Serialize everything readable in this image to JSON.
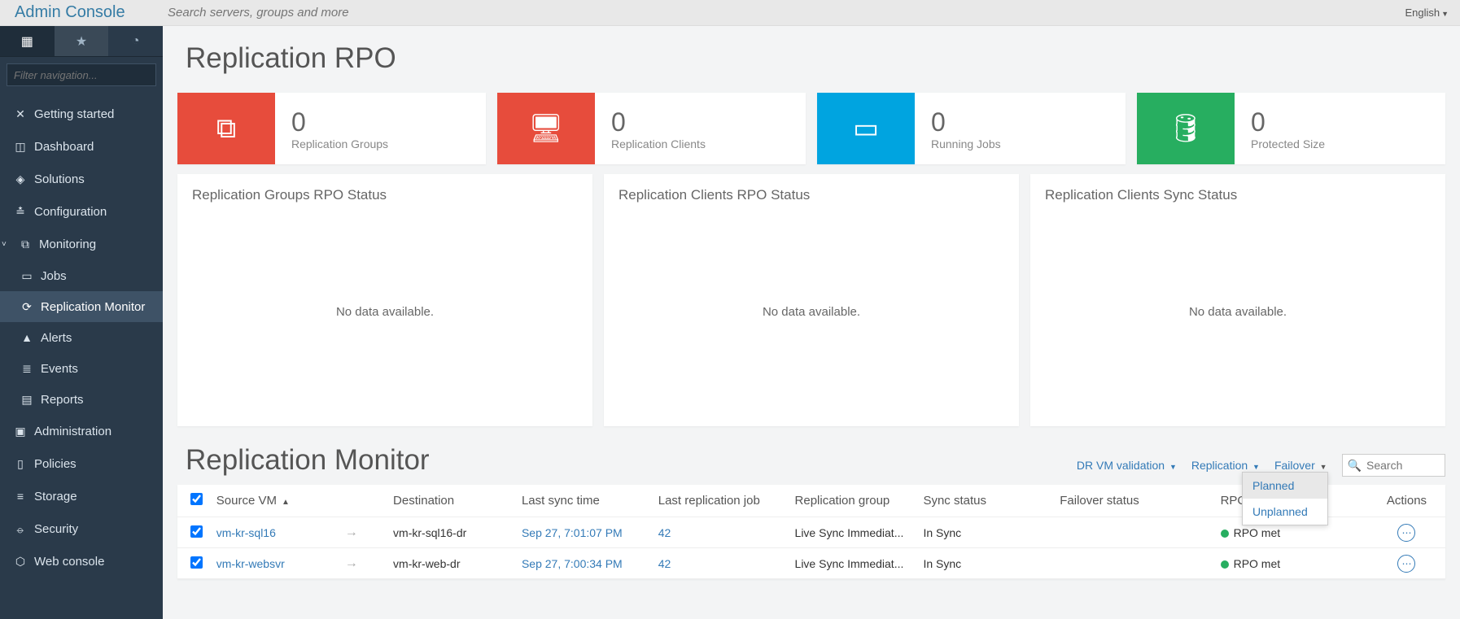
{
  "app_title": "Admin Console",
  "search_placeholder": "Search servers, groups and more",
  "language": "English",
  "nav_filter_placeholder": "Filter navigation...",
  "sidebar": {
    "items": [
      {
        "label": "Getting started",
        "icon": "✕"
      },
      {
        "label": "Dashboard",
        "icon": "📊"
      },
      {
        "label": "Solutions",
        "icon": "◈"
      },
      {
        "label": "Configuration",
        "icon": "⚙"
      },
      {
        "label": "Monitoring",
        "icon": "∨",
        "expanded": true,
        "children": [
          {
            "label": "Jobs",
            "icon": "💼"
          },
          {
            "label": "Replication Monitor",
            "icon": "⟳",
            "active": true
          },
          {
            "label": "Alerts",
            "icon": "▲"
          },
          {
            "label": "Events",
            "icon": "≣"
          },
          {
            "label": "Reports",
            "icon": "▤"
          }
        ]
      },
      {
        "label": "Administration",
        "icon": "👤"
      },
      {
        "label": "Policies",
        "icon": "📄"
      },
      {
        "label": "Storage",
        "icon": "≡"
      },
      {
        "label": "Security",
        "icon": "🔒"
      },
      {
        "label": "Web console",
        "icon": "⬡"
      }
    ]
  },
  "page_title": "Replication RPO",
  "kpis": [
    {
      "value": "0",
      "label": "Replication Groups",
      "color": "red",
      "icon": "⧉"
    },
    {
      "value": "0",
      "label": "Replication Clients",
      "color": "red",
      "icon": "🖥"
    },
    {
      "value": "0",
      "label": "Running Jobs",
      "color": "blue",
      "icon": "💼"
    },
    {
      "value": "0",
      "label": "Protected Size",
      "color": "green",
      "icon": "🛢"
    }
  ],
  "panels": [
    {
      "title": "Replication Groups RPO Status",
      "body": "No data available."
    },
    {
      "title": "Replication Clients RPO Status",
      "body": "No data available."
    },
    {
      "title": "Replication Clients Sync Status",
      "body": "No data available."
    }
  ],
  "monitor": {
    "title": "Replication Monitor",
    "actions": {
      "dr_validation": "DR VM validation",
      "replication": "Replication",
      "failover": "Failover",
      "dropdown": [
        {
          "label": "Planned",
          "hover": true
        },
        {
          "label": "Unplanned"
        }
      ]
    },
    "search_placeholder": "Search",
    "columns": {
      "source": "Source VM",
      "destination": "Destination",
      "last_sync": "Last sync time",
      "last_job": "Last replication job",
      "rep_group": "Replication group",
      "sync_status": "Sync status",
      "failover_status": "Failover status",
      "rpo_status": "RPO status",
      "actions": "Actions"
    },
    "rows": [
      {
        "source": "vm-kr-sql16",
        "destination": "vm-kr-sql16-dr",
        "last_sync": "Sep 27, 7:01:07 PM",
        "last_job": "42",
        "rep_group": "Live Sync Immediat...",
        "sync_status": "In Sync",
        "failover_status": "",
        "rpo_status": "RPO met"
      },
      {
        "source": "vm-kr-websvr",
        "destination": "vm-kr-web-dr",
        "last_sync": "Sep 27, 7:00:34 PM",
        "last_job": "42",
        "rep_group": "Live Sync Immediat...",
        "sync_status": "In Sync",
        "failover_status": "",
        "rpo_status": "RPO met"
      }
    ]
  }
}
